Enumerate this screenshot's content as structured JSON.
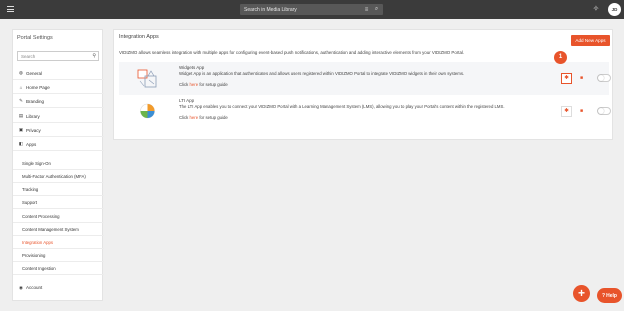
{
  "topbar": {
    "search_placeholder": "Search in Media Library",
    "avatar_initials": "JD"
  },
  "sidebar": {
    "title": "Portal Settings",
    "search_placeholder": "Search",
    "items": [
      {
        "label": "General",
        "icon": "globe-icon"
      },
      {
        "label": "Home Page",
        "icon": "home-icon"
      },
      {
        "label": "Branding",
        "icon": "brush-icon"
      },
      {
        "label": "Library",
        "icon": "library-icon"
      },
      {
        "label": "Privacy",
        "icon": "lock-icon"
      },
      {
        "label": "Apps",
        "icon": "apps-icon"
      }
    ],
    "sub_items": [
      {
        "label": "Single Sign-On"
      },
      {
        "label": "Multi-Factor Authentication (MFA)"
      },
      {
        "label": "Tracking"
      },
      {
        "label": "Support"
      },
      {
        "label": "Content Processing"
      },
      {
        "label": "Content Management System"
      },
      {
        "label": "Integration Apps"
      },
      {
        "label": "Provisioning"
      },
      {
        "label": "Content Ingestion"
      }
    ],
    "active_sub_item": "Integration Apps",
    "account": {
      "label": "Account",
      "icon": "user-icon"
    }
  },
  "main": {
    "title": "Integration Apps",
    "add_button": "Add New Apps",
    "description": "VIDIZMO allows seamless integration with multiple apps for configuring event-based push notifications, authentication and adding interactive elements from your VIDIZMO Portal.",
    "apps": [
      {
        "name": "Widgets App",
        "description": "Widget App is an application that authenticates and allows users registered within VIDIZMO Portal to integrate VIDIZMO widgets in their own systems.",
        "guide_prefix": "Click",
        "guide_link": "here",
        "guide_suffix": "for setup guide",
        "enabled": false,
        "icon": "puzzle-icon"
      },
      {
        "name": "LTI App",
        "description": "The LTI App enables you to connect your VIDIZMO Portal with a Learning Management System (LMS), allowing you to play your Portal's content within the registered LMS.",
        "guide_prefix": "Click",
        "guide_link": "here",
        "guide_suffix": "for setup guide",
        "enabled": false,
        "icon": "lti-icon"
      }
    ],
    "step_badge": "1"
  },
  "help": {
    "label": "Help"
  },
  "colors": {
    "accent": "#e8542b",
    "topbar": "#3b3b3b",
    "background": "#efefef"
  }
}
